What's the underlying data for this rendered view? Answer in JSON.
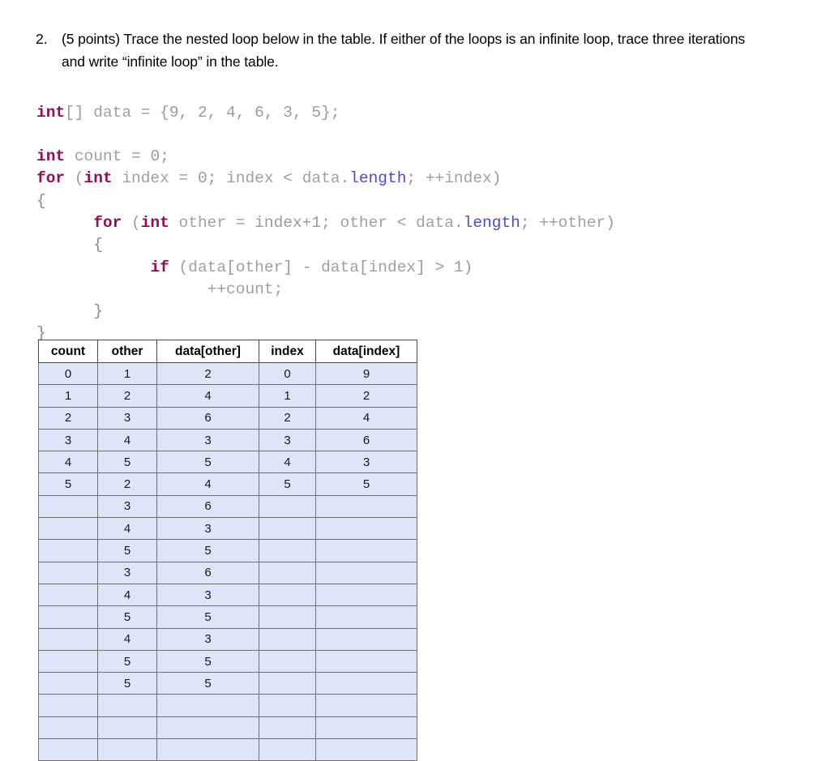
{
  "question": {
    "number": "2.",
    "text": "(5 points) Trace the nested loop below in the table. If either of the loops is an infinite loop, trace three iterations and write “infinite loop” in the table."
  },
  "code": {
    "language": "java",
    "lines": [
      [
        {
          "t": "int",
          "c": "kw"
        },
        {
          "t": "[] ",
          "c": "pun"
        },
        {
          "t": "data",
          "c": "pln"
        },
        {
          "t": " = ",
          "c": "pun"
        },
        {
          "t": "{9, 2, 4, 6, 3, 5};",
          "c": "pun"
        }
      ],
      [],
      [
        {
          "t": "int",
          "c": "kw"
        },
        {
          "t": " ",
          "c": "pun"
        },
        {
          "t": "count",
          "c": "pln"
        },
        {
          "t": " = ",
          "c": "pun"
        },
        {
          "t": "0;",
          "c": "pun"
        }
      ],
      [
        {
          "t": "for",
          "c": "kw"
        },
        {
          "t": " (",
          "c": "pun"
        },
        {
          "t": "int",
          "c": "kw"
        },
        {
          "t": " ",
          "c": "pun"
        },
        {
          "t": "index",
          "c": "pln"
        },
        {
          "t": " = ",
          "c": "pun"
        },
        {
          "t": "0; ",
          "c": "pun"
        },
        {
          "t": "index",
          "c": "pln"
        },
        {
          "t": " < ",
          "c": "pun"
        },
        {
          "t": "data",
          "c": "pln"
        },
        {
          "t": ".",
          "c": "pun"
        },
        {
          "t": "length",
          "c": "fld"
        },
        {
          "t": "; ++",
          "c": "pun"
        },
        {
          "t": "index",
          "c": "pln"
        },
        {
          "t": ")",
          "c": "pun"
        }
      ],
      [
        {
          "t": "{",
          "c": "brc"
        }
      ],
      [
        {
          "t": "      ",
          "c": "pun"
        },
        {
          "t": "for",
          "c": "kw"
        },
        {
          "t": " (",
          "c": "pun"
        },
        {
          "t": "int",
          "c": "kw"
        },
        {
          "t": " ",
          "c": "pun"
        },
        {
          "t": "other",
          "c": "pln"
        },
        {
          "t": " = ",
          "c": "pun"
        },
        {
          "t": "index+1; ",
          "c": "pun"
        },
        {
          "t": "other",
          "c": "pln"
        },
        {
          "t": " < ",
          "c": "pun"
        },
        {
          "t": "data",
          "c": "pln"
        },
        {
          "t": ".",
          "c": "pun"
        },
        {
          "t": "length",
          "c": "fld"
        },
        {
          "t": "; ++",
          "c": "pun"
        },
        {
          "t": "other",
          "c": "pln"
        },
        {
          "t": ")",
          "c": "pun"
        }
      ],
      [
        {
          "t": "      {",
          "c": "brc"
        }
      ],
      [
        {
          "t": "            ",
          "c": "pun"
        },
        {
          "t": "if",
          "c": "kw"
        },
        {
          "t": " (",
          "c": "pun"
        },
        {
          "t": "data",
          "c": "pln"
        },
        {
          "t": "[",
          "c": "pun"
        },
        {
          "t": "other",
          "c": "pln"
        },
        {
          "t": "] - ",
          "c": "pun"
        },
        {
          "t": "data",
          "c": "pln"
        },
        {
          "t": "[",
          "c": "pun"
        },
        {
          "t": "index",
          "c": "pln"
        },
        {
          "t": "] > 1)",
          "c": "pun"
        }
      ],
      [
        {
          "t": "                  ++",
          "c": "pun"
        },
        {
          "t": "count",
          "c": "pln"
        },
        {
          "t": ";",
          "c": "pun"
        }
      ],
      [
        {
          "t": "      }",
          "c": "brc"
        }
      ],
      [
        {
          "t": "}",
          "c": "brc"
        }
      ]
    ],
    "plain_text": "int[] data = {9, 2, 4, 6, 3, 5};\n\nint count = 0;\nfor (int index = 0; index < data.length; ++index)\n{\n      for (int other = index+1; other < data.length; ++other)\n      {\n            if (data[other] - data[index] > 1)\n                  ++count;\n      }\n}"
  },
  "table": {
    "headers": [
      "count",
      "other",
      "data[other]",
      "index",
      "data[index]"
    ],
    "rows": [
      [
        "0",
        "1",
        "2",
        "0",
        "9"
      ],
      [
        "1",
        "2",
        "4",
        "1",
        "2"
      ],
      [
        "2",
        "3",
        "6",
        "2",
        "4"
      ],
      [
        "3",
        "4",
        "3",
        "3",
        "6"
      ],
      [
        "4",
        "5",
        "5",
        "4",
        "3"
      ],
      [
        "5",
        "2",
        "4",
        "5",
        "5"
      ],
      [
        "",
        "3",
        "6",
        "",
        ""
      ],
      [
        "",
        "4",
        "3",
        "",
        ""
      ],
      [
        "",
        "5",
        "5",
        "",
        ""
      ],
      [
        "",
        "3",
        "6",
        "",
        ""
      ],
      [
        "",
        "4",
        "3",
        "",
        ""
      ],
      [
        "",
        "5",
        "5",
        "",
        ""
      ],
      [
        "",
        "4",
        "3",
        "",
        ""
      ],
      [
        "",
        "5",
        "5",
        "",
        ""
      ],
      [
        "",
        "5",
        "5",
        "",
        ""
      ],
      [
        "",
        "",
        "",
        "",
        ""
      ],
      [
        "",
        "",
        "",
        "",
        ""
      ],
      [
        "",
        "",
        "",
        "",
        ""
      ]
    ]
  },
  "colors": {
    "keyword": "#8f0f55",
    "field": "#4a4ad0",
    "plain": "#a0a0a0",
    "row_fill": "#dfe5f8",
    "grid": "#5f5f5f",
    "text": "#000000"
  }
}
